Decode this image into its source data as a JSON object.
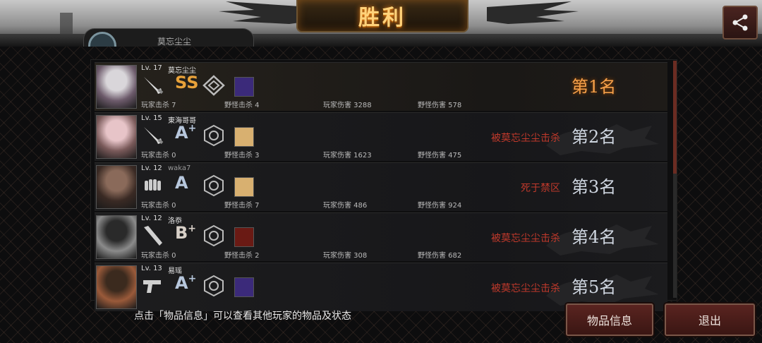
{
  "header": {
    "title": "胜利",
    "self_name": "莫忘尘尘"
  },
  "players": [
    {
      "level": "Lv. 17",
      "name": "莫忘尘尘",
      "weapon": "knife-icon",
      "grade": "SS",
      "grade_plus": "",
      "grade_color": "#e8a23a",
      "kills_label": "玩家击杀 7",
      "monster_label": "野怪击杀 4",
      "player_dmg_label": "玩家伤害 3288",
      "monster_dmg_label": "野怪伤害 578",
      "death": "",
      "rank": "第1名"
    },
    {
      "level": "Lv. 15",
      "name": "東海哥哥",
      "weapon": "knife-icon",
      "grade": "A",
      "grade_plus": "+",
      "grade_color": "#b7c7dc",
      "kills_label": "玩家击杀 0",
      "monster_label": "野怪击杀 3",
      "player_dmg_label": "玩家伤害 1623",
      "monster_dmg_label": "野怪伤害 475",
      "death": "被莫忘尘尘击杀",
      "rank": "第2名"
    },
    {
      "level": "Lv. 12",
      "name": "waka7",
      "weapon": "fist-icon",
      "grade": "A",
      "grade_plus": "",
      "grade_color": "#b7c7dc",
      "kills_label": "玩家击杀 0",
      "monster_label": "野怪击杀 7",
      "player_dmg_label": "玩家伤害 486",
      "monster_dmg_label": "野怪伤害 924",
      "death": "死于禁区",
      "rank": "第3名"
    },
    {
      "level": "Lv. 12",
      "name": "洛忝",
      "weapon": "bat-icon",
      "grade": "B",
      "grade_plus": "+",
      "grade_color": "#d8d0c8",
      "kills_label": "玩家击杀 0",
      "monster_label": "野怪击杀 2",
      "player_dmg_label": "玩家伤害 308",
      "monster_dmg_label": "野怪伤害 682",
      "death": "被莫忘尘尘击杀",
      "rank": "第4名"
    },
    {
      "level": "Lv. 13",
      "name": "易瑶",
      "weapon": "pistol-icon",
      "grade": "A",
      "grade_plus": "+",
      "grade_color": "#b7c7dc",
      "kills_label": "",
      "monster_label": "",
      "player_dmg_label": "",
      "monster_dmg_label": "",
      "death": "被莫忘尘尘击杀",
      "rank": "第5名"
    }
  ],
  "footer": {
    "hint": "点击「物品信息」可以查看其他玩家的物品及状态",
    "items_button": "物品信息",
    "exit_button": "退出"
  },
  "colors": {
    "accent": "#f5a04a",
    "death_text": "#c0392b",
    "button_bg": "#5a2420"
  }
}
